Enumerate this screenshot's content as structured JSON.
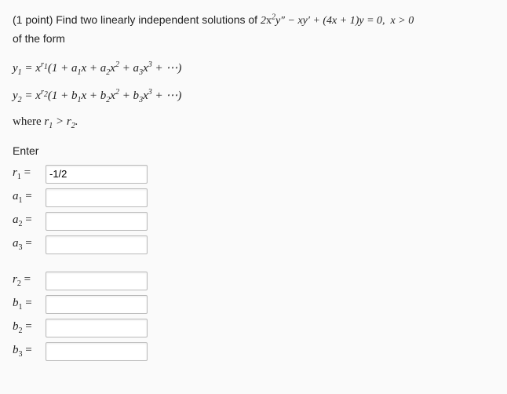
{
  "points": "(1 point)",
  "problem_lead": " Find two linearly independent solutions of ",
  "ode": "2x²y″ − xy′ + (4x + 1)y = 0,  x > 0",
  "problem_tail": "of the form",
  "eq_y1": "y₁ = x^{r₁}(1 + a₁x + a₂x² + a₃x³ + ⋯)",
  "eq_y2": "y₂ = x^{r₂}(1 + b₁x + b₂x² + b₃x³ + ⋯)",
  "where_text": "where r₁ > r₂.",
  "enter_text": "Enter",
  "inputs": {
    "r1": {
      "label": "r₁",
      "value": "-1/2"
    },
    "a1": {
      "label": "a₁",
      "value": ""
    },
    "a2": {
      "label": "a₂",
      "value": ""
    },
    "a3": {
      "label": "a₃",
      "value": ""
    },
    "r2": {
      "label": "r₂",
      "value": ""
    },
    "b1": {
      "label": "b₁",
      "value": ""
    },
    "b2": {
      "label": "b₂",
      "value": ""
    },
    "b3": {
      "label": "b₃",
      "value": ""
    }
  }
}
